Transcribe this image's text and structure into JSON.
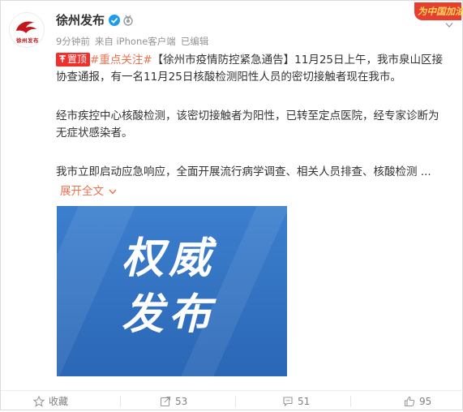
{
  "post": {
    "author": "徐州发布",
    "avatar_caption": "徐州发布",
    "meta": {
      "time": "9分钟前",
      "source": "来自 iPhone客户端",
      "edited": "已编辑"
    },
    "corner_badge": "为中国加油",
    "pin_label": "置顶",
    "topic": "#重点关注#",
    "lines": {
      "p1a": "【徐州市疫情防控紧急通告】11月25日上午，我市泉山区接",
      "p1b": "协查通报，有一名11月25日核酸检测阳性人员的密切接触者现在我市。",
      "p2a": "经市疾控中心核酸检测，该密切接触者为阳性，已转至定点医院，经专家诊断为",
      "p2b": "无症状感染者。",
      "p3": "我市立即启动应急响应，全面开展流行病学调查、相关人员排查、核酸检测 ..."
    },
    "expand_label": "展开全文",
    "image_text": {
      "line1": "权威",
      "line2": "发布"
    },
    "colors": {
      "accent": "#eb7350",
      "pin": "#f0302d",
      "image_bg": "#2d6ebd"
    }
  },
  "actions": {
    "favorite": "收藏",
    "repost_count": "53",
    "comment_count": "51",
    "like_count": "95"
  }
}
